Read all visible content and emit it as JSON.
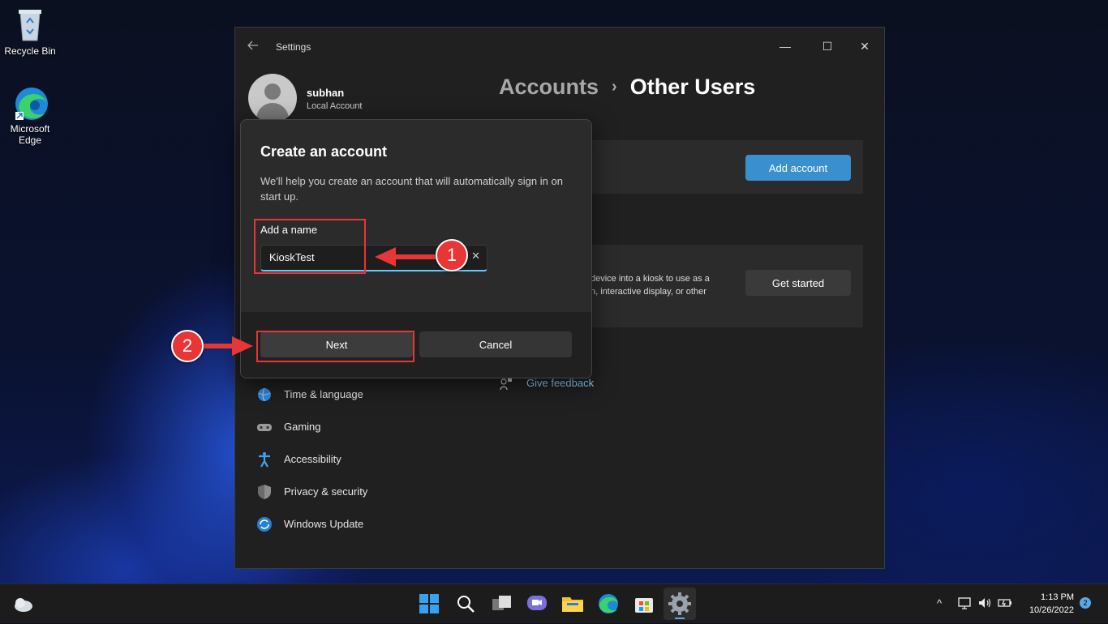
{
  "desktop": {
    "icons": [
      {
        "label": "Recycle Bin"
      },
      {
        "label": "Microsoft Edge"
      }
    ]
  },
  "window": {
    "title": "Settings",
    "controls": {
      "minimize": "—",
      "maximize": "☐",
      "close": "✕"
    }
  },
  "user": {
    "name": "subhan",
    "type": "Local Account"
  },
  "breadcrumb": {
    "parent": "Accounts",
    "separator": "›",
    "current": "Other Users"
  },
  "main": {
    "add_account_label": "Add account",
    "kiosk_line1": "device into a kiosk to use as a",
    "kiosk_line2": "n, interactive display, or other",
    "get_started_label": "Get started",
    "feedback_label": "Give feedback"
  },
  "nav": {
    "items": [
      {
        "label": "Time & language"
      },
      {
        "label": "Gaming"
      },
      {
        "label": "Accessibility"
      },
      {
        "label": "Privacy & security"
      },
      {
        "label": "Windows Update"
      }
    ]
  },
  "dialog": {
    "title": "Create an account",
    "description": "We'll help you create an account that will automatically sign in on start up.",
    "name_label": "Add a name",
    "name_value": "KioskTest",
    "clear_glyph": "✕",
    "next_label": "Next",
    "cancel_label": "Cancel"
  },
  "annotations": {
    "step1": "1",
    "step2": "2",
    "color": "#e83535"
  },
  "taskbar": {
    "clock_time": "1:13 PM",
    "clock_date": "10/26/2022",
    "notification_count": "2",
    "tray_chevron": "^"
  }
}
